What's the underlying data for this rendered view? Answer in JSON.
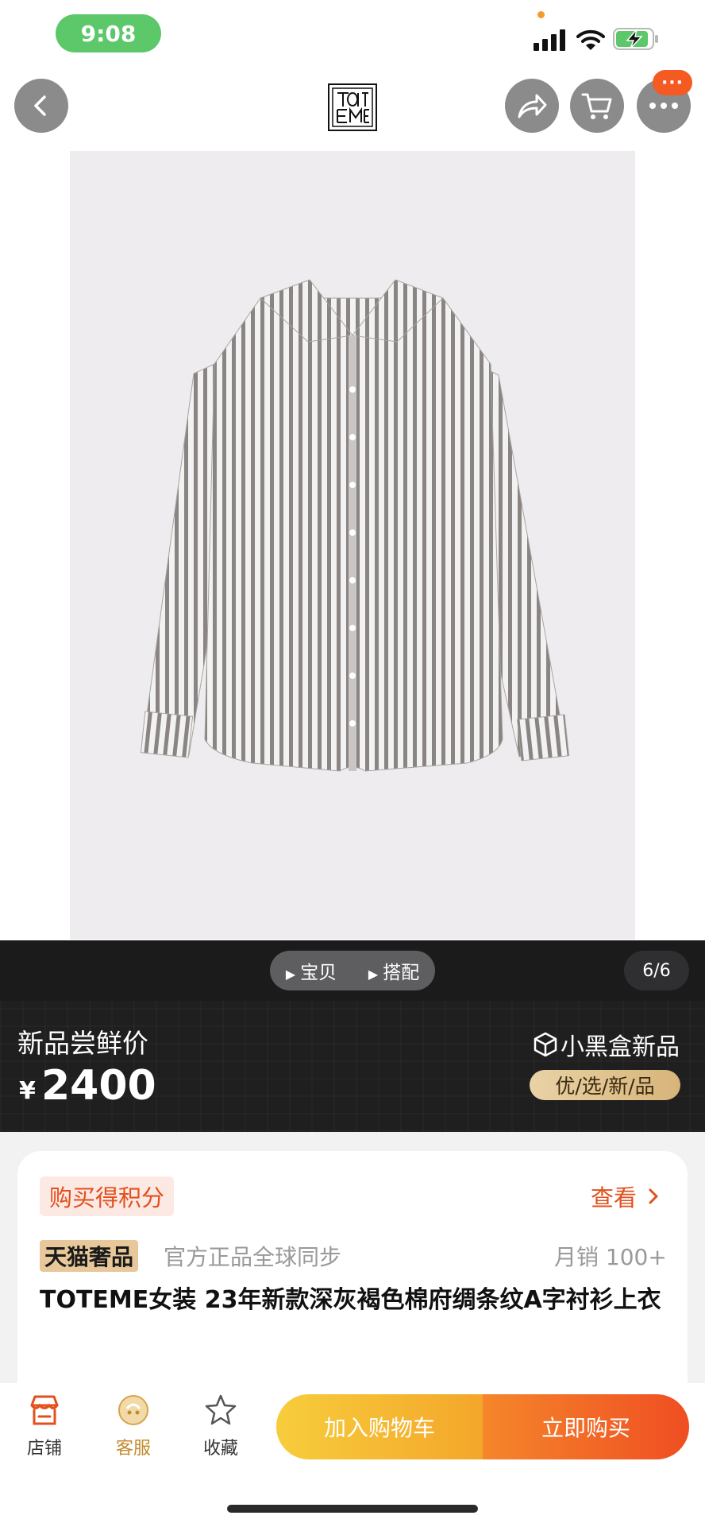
{
  "status_bar": {
    "time": "9:08"
  },
  "header": {
    "more_badge": "···",
    "brand_logo": "TOTEME"
  },
  "media": {
    "tabs": [
      "宝贝",
      "搭配"
    ],
    "counter": "6/6"
  },
  "price_bar": {
    "label": "新品尝鲜价",
    "currency": "¥",
    "price": "2400",
    "channel": "小黑盒新品",
    "channel_tag": "优/选/新/品"
  },
  "info": {
    "points_label": "购买得积分",
    "check_label": "查看",
    "tmall_badge": "天猫奢品",
    "official_text": "官方正品全球同步",
    "monthly_sales": "月销 100+",
    "product_title": "TOTEME女装 23年新款深灰褐色棉府绸条纹A字衬衫上衣"
  },
  "bottom_bar": {
    "store": "店铺",
    "service": "客服",
    "favorite": "收藏",
    "add_to_cart": "加入购物车",
    "buy_now": "立即购买"
  },
  "colors": {
    "accent_orange": "#ef4e22",
    "cart_yellow": "#f7cd3c",
    "time_green": "#5cc86a",
    "gold": "#e8c89a"
  }
}
